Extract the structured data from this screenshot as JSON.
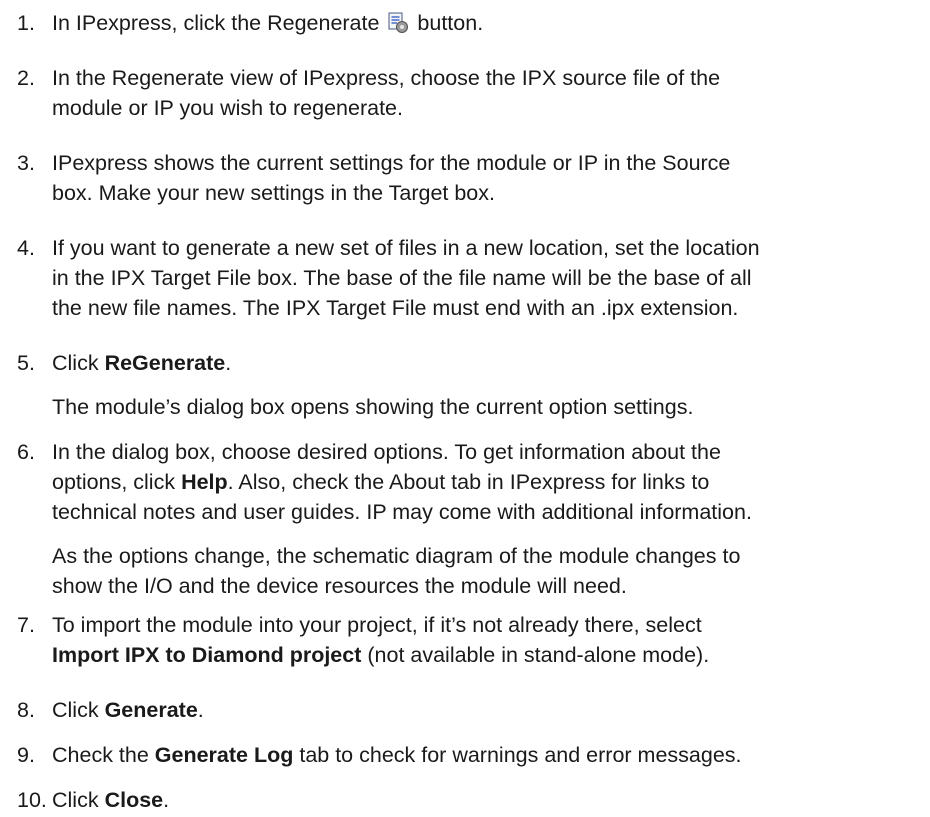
{
  "steps": [
    {
      "num": "1.",
      "a": "In IPexpress, click the Regenerate",
      "b": "button."
    },
    {
      "num": "2.",
      "l1": "In the Regenerate view of IPexpress, choose the IPX source file of the",
      "l2": "module or IP you wish to regenerate."
    },
    {
      "num": "3.",
      "l1": "IPexpress shows the current settings for the module or IP in the Source",
      "l2": "box. Make your new settings in the Target box."
    },
    {
      "num": "4.",
      "l1": "If you want to generate a new set of files in a new location, set the location",
      "l2": "in the IPX Target File box. The base of the file name will be the base of all",
      "l3": "the new file names. The IPX Target File must end with an .ipx extension."
    },
    {
      "num": "5.",
      "pre": "Click ",
      "bold": "ReGenerate",
      "post": ".",
      "note": "The module’s dialog box opens showing the current option settings."
    },
    {
      "num": "6.",
      "l1": "In the dialog box, choose desired options. To get information about the",
      "l2pre": "options, click ",
      "l2bold": "Help",
      "l2post": ". Also, check the About tab in IPexpress for links to",
      "l3": "technical notes and user guides. IP may come with additional information.",
      "n1": "As the options change, the schematic diagram of the module changes to",
      "n2": "show the I/O and the device resources the module will need."
    },
    {
      "num": "7.",
      "l1": "To import the module into your project, if it’s not already there, select",
      "l2bold": "Import IPX to Diamond project",
      "l2post": " (not available in stand-alone mode)."
    },
    {
      "num": "8.",
      "pre": "Click ",
      "bold": "Generate",
      "post": "."
    },
    {
      "num": "9.",
      "pre": "Check the ",
      "bold": "Generate Log",
      "post": " tab to check for warnings and error messages."
    },
    {
      "num": "10.",
      "pre": "Click ",
      "bold": "Close",
      "post": "."
    }
  ]
}
